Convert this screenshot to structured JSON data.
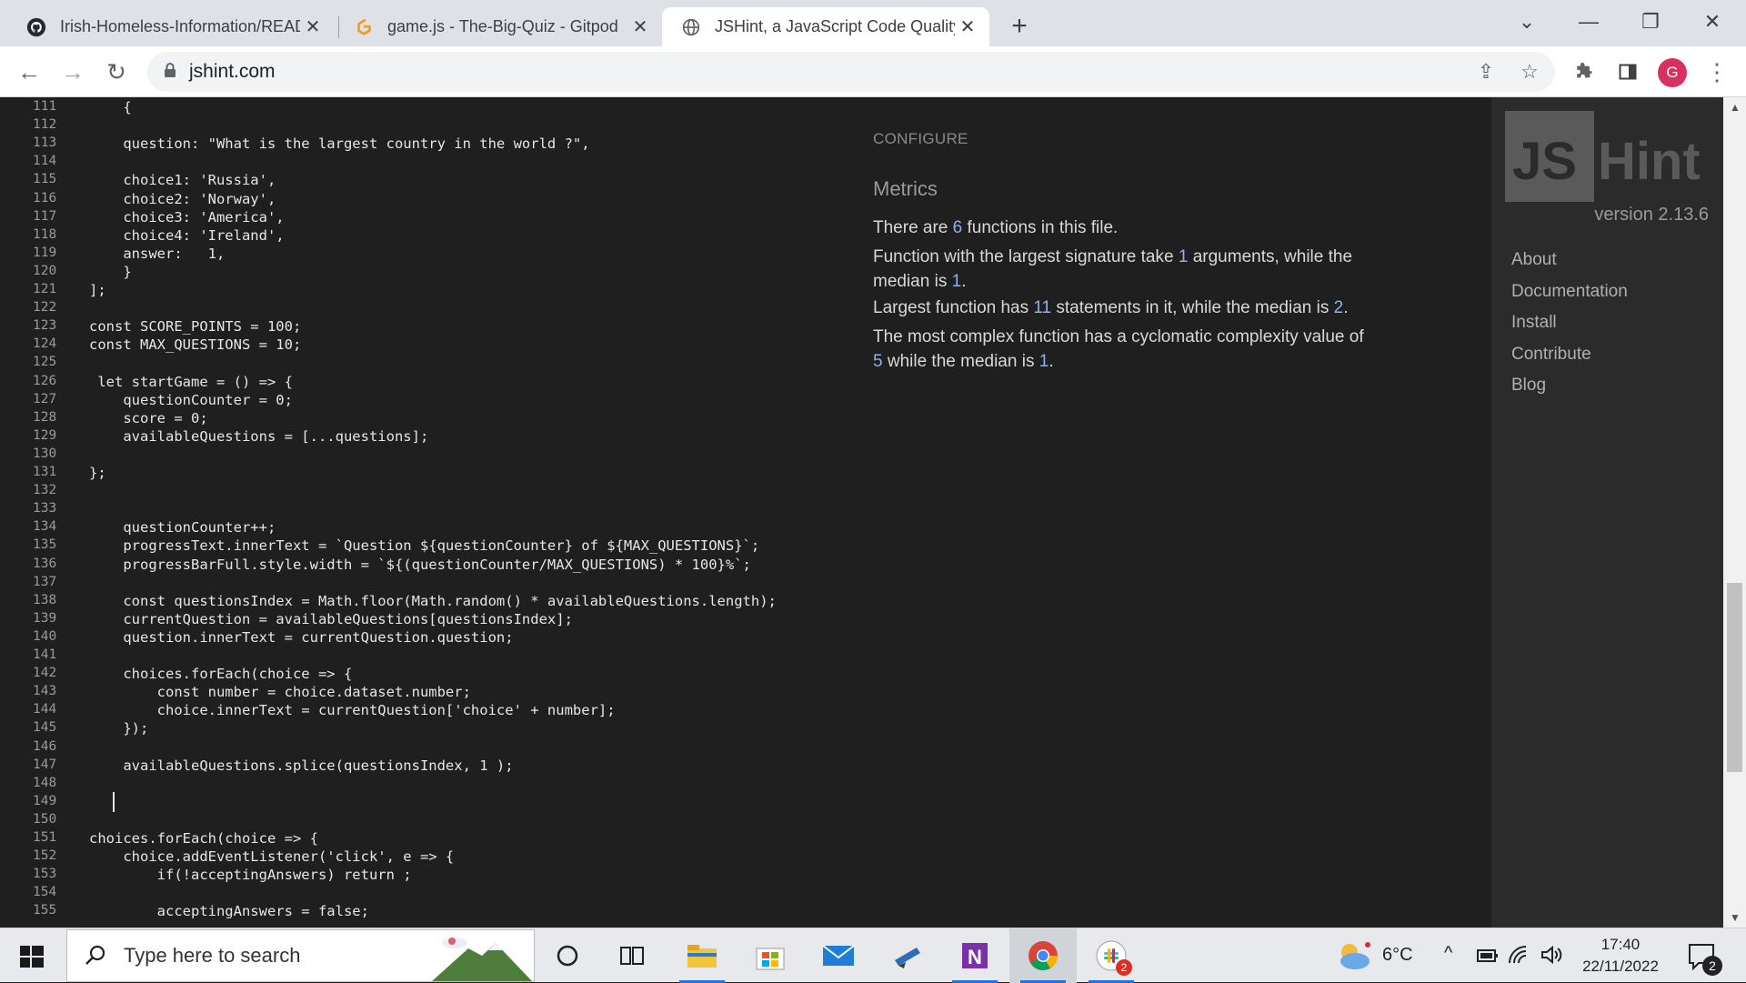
{
  "browser": {
    "tabs": [
      {
        "title": "Irish-Homeless-Information/READ",
        "icon": "github-icon",
        "active": false
      },
      {
        "title": "game.js - The-Big-Quiz - Gitpod",
        "icon": "gitpod-icon",
        "active": false
      },
      {
        "title": "JSHint, a JavaScript Code Quality",
        "icon": "globe-icon",
        "active": true
      }
    ],
    "url": "jshint.com",
    "profile_initial": "G"
  },
  "editor": {
    "lines": [
      {
        "n": "111",
        "t": "    {"
      },
      {
        "n": "112",
        "t": ""
      },
      {
        "n": "113",
        "t": "    question: \"What is the largest country in the world ?\","
      },
      {
        "n": "114",
        "t": ""
      },
      {
        "n": "115",
        "t": "    choice1: 'Russia',"
      },
      {
        "n": "116",
        "t": "    choice2: 'Norway',"
      },
      {
        "n": "117",
        "t": "    choice3: 'America',"
      },
      {
        "n": "118",
        "t": "    choice4: 'Ireland',"
      },
      {
        "n": "119",
        "t": "    answer:   1,"
      },
      {
        "n": "120",
        "t": "    }"
      },
      {
        "n": "121",
        "t": "];"
      },
      {
        "n": "122",
        "t": ""
      },
      {
        "n": "123",
        "t": "const SCORE_POINTS = 100;"
      },
      {
        "n": "124",
        "t": "const MAX_QUESTIONS = 10;"
      },
      {
        "n": "125",
        "t": ""
      },
      {
        "n": "126",
        "t": " let startGame = () => {"
      },
      {
        "n": "127",
        "t": "    questionCounter = 0;"
      },
      {
        "n": "128",
        "t": "    score = 0;"
      },
      {
        "n": "129",
        "t": "    availableQuestions = [...questions];"
      },
      {
        "n": "130",
        "t": ""
      },
      {
        "n": "131",
        "t": "};"
      },
      {
        "n": "132",
        "t": ""
      },
      {
        "n": "133",
        "t": ""
      },
      {
        "n": "134",
        "t": "    questionCounter++;"
      },
      {
        "n": "135",
        "t": "    progressText.innerText = `Question ${questionCounter} of ${MAX_QUESTIONS}`;"
      },
      {
        "n": "136",
        "t": "    progressBarFull.style.width = `${(questionCounter/MAX_QUESTIONS) * 100}%`;"
      },
      {
        "n": "137",
        "t": ""
      },
      {
        "n": "138",
        "t": "    const questionsIndex = Math.floor(Math.random() * availableQuestions.length);"
      },
      {
        "n": "139",
        "t": "    currentQuestion = availableQuestions[questionsIndex];"
      },
      {
        "n": "140",
        "t": "    question.innerText = currentQuestion.question;"
      },
      {
        "n": "141",
        "t": ""
      },
      {
        "n": "142",
        "t": "    choices.forEach(choice => {"
      },
      {
        "n": "143",
        "t": "        const number = choice.dataset.number;"
      },
      {
        "n": "144",
        "t": "        choice.innerText = currentQuestion['choice' + number];"
      },
      {
        "n": "145",
        "t": "    });"
      },
      {
        "n": "146",
        "t": ""
      },
      {
        "n": "147",
        "t": "    availableQuestions.splice(questionsIndex, 1 );"
      },
      {
        "n": "148",
        "t": ""
      },
      {
        "n": "149",
        "t": ""
      },
      {
        "n": "150",
        "t": ""
      },
      {
        "n": "151",
        "t": "choices.forEach(choice => {"
      },
      {
        "n": "152",
        "t": "    choice.addEventListener('click', e => {"
      },
      {
        "n": "153",
        "t": "        if(!acceptingAnswers) return ;"
      },
      {
        "n": "154",
        "t": ""
      },
      {
        "n": "155",
        "t": "        acceptingAnswers = false;"
      }
    ]
  },
  "report": {
    "configure": "CONFIGURE",
    "metrics_title": "Metrics",
    "functions_count": "6",
    "largest_signature": "1",
    "signature_median": "1",
    "largest_statements": "11",
    "statements_median": "2",
    "complexity_value": "5",
    "complexity_median": "1",
    "text": {
      "functions_a": "There are ",
      "functions_b": " functions in this file.",
      "sig_a": "Function with the largest signature take ",
      "sig_b": " arguments, while the median is ",
      "sig_c": ".",
      "stmt_a": "Largest function has ",
      "stmt_b": " statements in it, while the median is ",
      "stmt_c": ".",
      "cx_a": "The most complex function has a cyclomatic complexity value of ",
      "cx_b": " while the median is ",
      "cx_c": "."
    }
  },
  "sidebar": {
    "logo_text": "JSHint",
    "version": "version 2.13.6",
    "links": [
      "About",
      "Documentation",
      "Install",
      "Contribute",
      "Blog"
    ]
  },
  "taskbar": {
    "search_placeholder": "Type here to search",
    "temperature": "6°C",
    "time": "17:40",
    "date": "22/11/2022",
    "notification_count": "2",
    "slack_badge": "2"
  },
  "colors": {
    "accent": "#1a73e8",
    "metric_number": "#8fb0e8",
    "page_bg": "#1f1f1f",
    "sidebar_bg": "#2b2b2b"
  }
}
